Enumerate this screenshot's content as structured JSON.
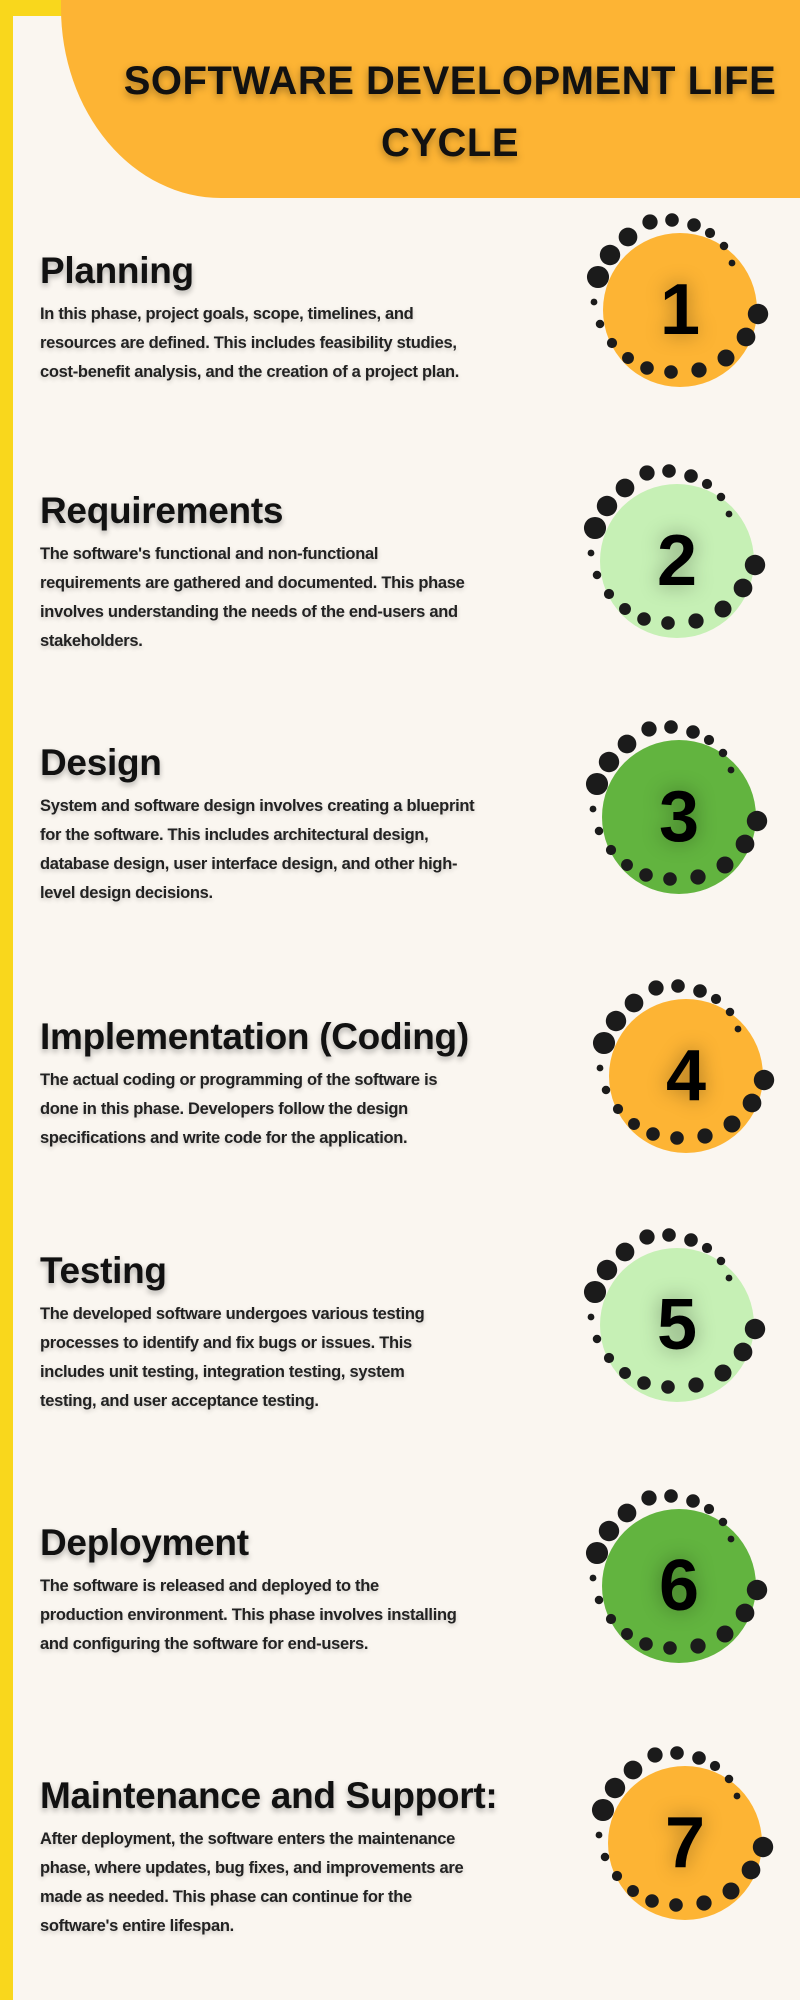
{
  "title": "SOFTWARE DEVELOPMENT LIFE CYCLE",
  "colors": {
    "orange": "#fdb434",
    "light_green": "#c6f0b5",
    "green": "#62b43f",
    "dot": "#1b1b1b",
    "background": "#faf6f0",
    "border": "#f9d71c"
  },
  "phases": [
    {
      "number": "1",
      "title": "Planning",
      "color": "orange",
      "lines": [
        " In this phase, project goals, scope, timelines, and",
        "resources are defined. This includes feasibility studies,",
        "cost-benefit analysis, and the creation of a project plan."
      ]
    },
    {
      "number": "2",
      "title": "Requirements",
      "color": "light_green",
      "lines": [
        "The software's functional and non-functional",
        "requirements are gathered and documented. This phase",
        "involves understanding the needs of the end-users and",
        "stakeholders."
      ]
    },
    {
      "number": "3",
      "title": "Design",
      "color": "green",
      "lines": [
        "System and software design involves creating a blueprint",
        "for the software. This includes architectural design,",
        "database design, user interface design, and other high-",
        "level design decisions."
      ]
    },
    {
      "number": "4",
      "title": "Implementation (Coding)",
      "color": "orange",
      "lines": [
        " The actual coding or programming of the software is",
        "done in this phase. Developers follow the design",
        "specifications and write code for the application."
      ]
    },
    {
      "number": "5",
      "title": "Testing",
      "color": "light_green",
      "lines": [
        "The developed software undergoes various testing",
        "processes to identify and fix bugs or issues. This",
        "includes unit testing, integration testing, system",
        "testing, and user acceptance testing."
      ]
    },
    {
      "number": "6",
      "title": "Deployment",
      "color": "green",
      "lines": [
        "The software is released and deployed to the",
        "production environment. This phase involves installing",
        "and configuring the software for end-users."
      ]
    },
    {
      "number": "7",
      "title": "Maintenance and Support:",
      "color": "orange",
      "lines": [
        " After deployment, the software enters the maintenance",
        "phase, where updates, bug fixes, and improvements are",
        "made as needed. This phase can continue for the",
        "software's entire lifespan."
      ]
    }
  ]
}
